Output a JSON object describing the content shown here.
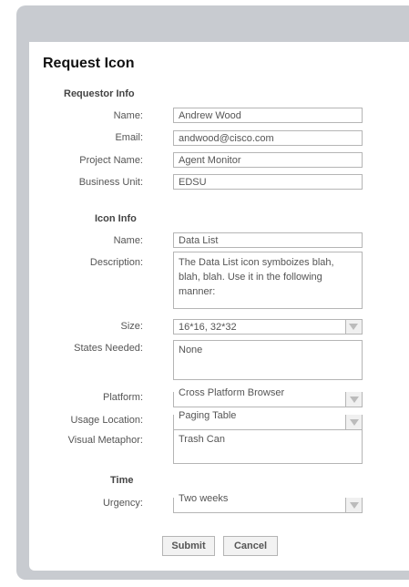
{
  "form": {
    "title": "Request Icon",
    "requestor": {
      "heading": "Requestor Info",
      "name_label": "Name:",
      "name_value": "Andrew Wood",
      "email_label": "Email:",
      "email_value": "andwood@cisco.com",
      "project_label": "Project Name:",
      "project_value": "Agent Monitor",
      "business_label": "Business Unit:",
      "business_value": "EDSU"
    },
    "icon": {
      "heading": "Icon Info",
      "name_label": "Name:",
      "name_value": "Data List",
      "description_label": "Description:",
      "description_value": "The Data List icon symboizes blah, blah, blah. Use it in the following manner:",
      "size_label": "Size:",
      "size_value": "16*16, 32*32",
      "states_label": "States Needed:",
      "states_value": "None",
      "platform_label": "Platform:",
      "platform_value": "Cross Platform Browser",
      "usage_label": "Usage Location:",
      "usage_value": "Paging Table",
      "metaphor_label": "Visual Metaphor:",
      "metaphor_value": "Trash Can"
    },
    "time": {
      "heading": "Time",
      "urgency_label": "Urgency:",
      "urgency_value": "Two weeks"
    },
    "buttons": {
      "submit": "Submit",
      "cancel": "Cancel"
    }
  }
}
